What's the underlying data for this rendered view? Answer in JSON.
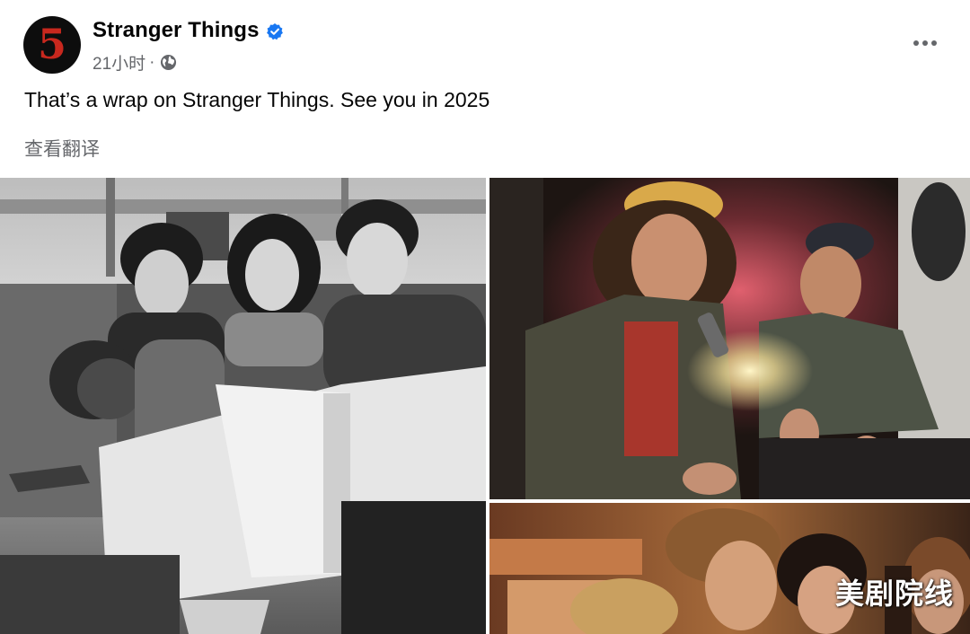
{
  "post": {
    "avatar_text": "5",
    "page_name": "Stranger Things",
    "time": "21小时",
    "separator": "·",
    "text": "That’s a wrap on Stranger Things. See you in 2025",
    "translate_label": "查看翻译",
    "watermark": "美剧院线"
  },
  "icons": {
    "verified": "verified-badge-icon",
    "audience": "globe-icon",
    "more": "more-options-icon"
  },
  "colors": {
    "verified_blue": "#1877f2",
    "secondary_text": "#65676b",
    "avatar_bg": "#0d0d0d",
    "avatar_numeral": "#c8281e"
  },
  "photos": [
    {
      "description_tone": "black-and-white"
    },
    {
      "description_tone": "warm-dark"
    },
    {
      "description_tone": "warm-dim"
    }
  ]
}
